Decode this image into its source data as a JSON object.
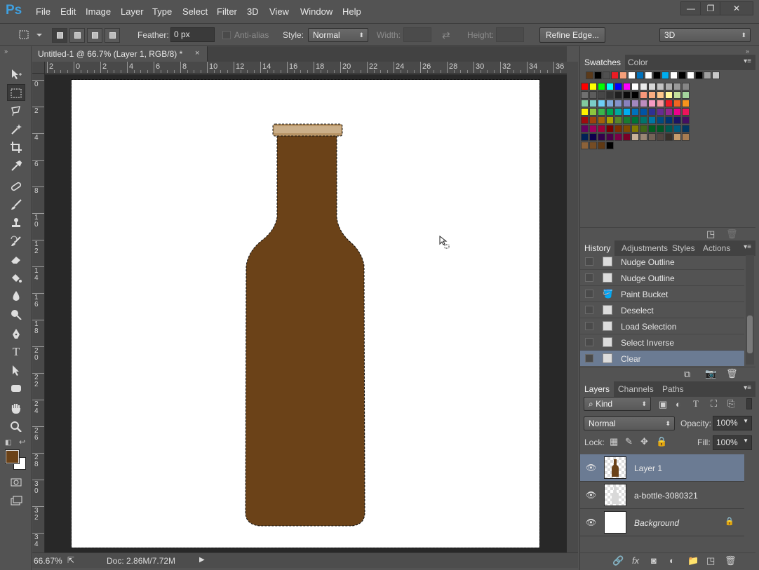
{
  "app": {
    "logo": "Ps"
  },
  "menu": [
    "File",
    "Edit",
    "Image",
    "Layer",
    "Type",
    "Select",
    "Filter",
    "3D",
    "View",
    "Window",
    "Help"
  ],
  "window_controls": {
    "minimize": "—",
    "maximize": "❐",
    "close": "✕"
  },
  "options": {
    "feather_label": "Feather:",
    "feather_value": "0 px",
    "antialias_label": "Anti-alias",
    "style_label": "Style:",
    "style_value": "Normal",
    "width_label": "Width:",
    "swap_icon": "⇄",
    "height_label": "Height:",
    "refine_edge": "Refine Edge...",
    "workspace": "3D"
  },
  "document": {
    "tab_title": "Untitled-1 @ 66.7% (Layer 1, RGB/8) *",
    "close": "×",
    "ruler_h": [
      "2",
      "0",
      "2",
      "4",
      "6",
      "8",
      "10",
      "12",
      "14",
      "16",
      "18",
      "20",
      "22",
      "24",
      "26",
      "28",
      "30",
      "32",
      "34",
      "36"
    ],
    "ruler_v": [
      "0",
      "2",
      "4",
      "6",
      "8",
      "10",
      "12",
      "14",
      "16",
      "18",
      "20",
      "22",
      "24",
      "26",
      "28",
      "30",
      "32",
      "34"
    ],
    "fill_color": "#6b4218"
  },
  "status": {
    "zoom": "66.67%",
    "doc": "Doc: 2.86M/7.72M"
  },
  "colors": {
    "foreground": "#6b4218",
    "background": "#ffffff",
    "selection_accent": "#6b7b93"
  },
  "swatches_panel": {
    "tabs": [
      "Swatches",
      "Color"
    ],
    "recent": [
      "#5b3a1a",
      "#000000",
      "#505050",
      "#ed1c24",
      "#f7a07a",
      "#ffffff",
      "#0072bc",
      "#ffffff",
      "#000000",
      "#00aeef",
      "#ffffff",
      "#000000",
      "#ffffff",
      "#000000",
      "#a0a0a0",
      "#c8c8c8"
    ],
    "grid": [
      [
        "#ff0000",
        "#ffff00",
        "#00ff00",
        "#00ffff",
        "#0000ff",
        "#ff00ff",
        "#ffffff",
        "#ebebeb",
        "#d6d6d6",
        "#c2c2c2",
        "#adadad",
        "#999999",
        "#858585",
        "#707070",
        "#5c5c5c",
        "#474747",
        "#333333",
        "#1f1f1f",
        "#0a0a0a",
        "#000000",
        "#f7977a",
        "#f9ad81",
        "#fdc68a",
        "#fff79a",
        "#c4df9b",
        "#a3d39c"
      ],
      [
        "#82ca9d",
        "#7bcdc8",
        "#6ecff6",
        "#7ea7d8",
        "#8493ca",
        "#8882be",
        "#a187be",
        "#bc8dbf",
        "#f49ac2",
        "#f6989d",
        "#ed1c24",
        "#f26522",
        "#f7941d",
        "#fff200",
        "#8dc63f",
        "#39b54a",
        "#00a651",
        "#00a99d",
        "#00aeef",
        "#0072bc",
        "#0054a6",
        "#2e3192",
        "#662d91",
        "#92278f",
        "#ec008c",
        "#ed145b"
      ],
      [
        "#9e0b0f",
        "#a0410d",
        "#a36209",
        "#aba000",
        "#598527",
        "#197b30",
        "#007236",
        "#00746b",
        "#0076a3",
        "#004b80",
        "#003471",
        "#1b1464",
        "#440e62",
        "#630460",
        "#9e005d",
        "#9e0039",
        "#790000",
        "#7b2e00",
        "#7d4900",
        "#827b00",
        "#406618",
        "#005e20",
        "#005826",
        "#005952",
        "#005b7f",
        "#003663"
      ],
      [
        "#002157",
        "#0d004c",
        "#32004b",
        "#4b0049",
        "#7b0046",
        "#7a0026",
        "#c7b299",
        "#998675",
        "#736357",
        "#534741",
        "#37302a",
        "#c69c6d",
        "#a67c52",
        "#8c6239",
        "#754c24",
        "#603913",
        "#000000"
      ]
    ]
  },
  "history_panel": {
    "tabs": [
      "History",
      "Adjustments",
      "Styles",
      "Actions"
    ],
    "items": [
      "Nudge Outline",
      "Nudge Outline",
      "Paint Bucket",
      "Deselect",
      "Load Selection",
      "Select Inverse",
      "Clear"
    ],
    "selected_index": 6
  },
  "layers_panel": {
    "tabs": [
      "Layers",
      "Channels",
      "Paths"
    ],
    "kind": "Kind",
    "blend_mode": "Normal",
    "opacity_label": "Opacity:",
    "opacity_value": "100%",
    "lock_label": "Lock:",
    "fill_label": "Fill:",
    "fill_value": "100%",
    "layers": [
      {
        "name": "Layer 1"
      },
      {
        "name": "a-bottle-3080321"
      },
      {
        "name": "Background"
      }
    ]
  }
}
